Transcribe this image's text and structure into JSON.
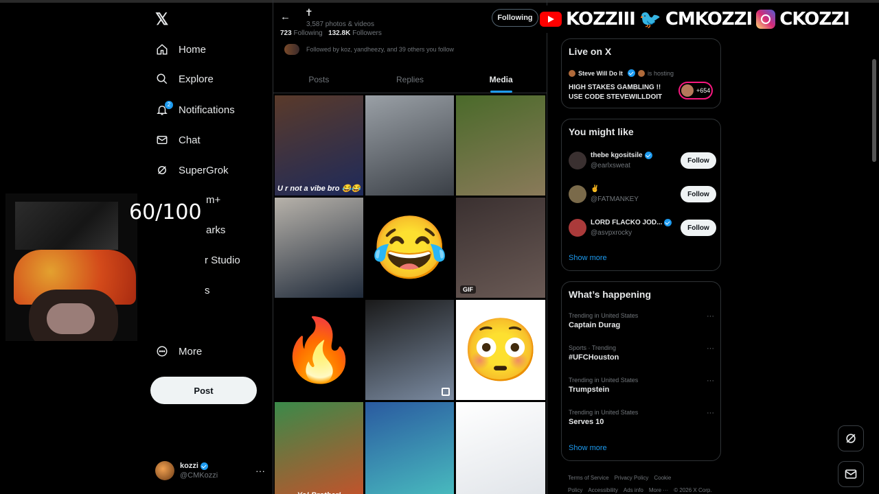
{
  "nav": {
    "items": [
      {
        "label": "Home",
        "icon": "home-icon"
      },
      {
        "label": "Explore",
        "icon": "search-icon"
      },
      {
        "label": "Notifications",
        "icon": "bell-icon",
        "badge": "2"
      },
      {
        "label": "Chat",
        "icon": "mail-icon"
      },
      {
        "label": "SuperGrok",
        "icon": "grok-icon"
      }
    ],
    "partial_items": [
      "m+",
      "arks",
      "r Studio",
      "s"
    ],
    "more_label": "More",
    "post_label": "Post",
    "account": {
      "name": "kozzi",
      "handle": "@CMKozzi",
      "more": "···"
    }
  },
  "overlay": {
    "score": "60/100",
    "banner": {
      "youtube": "KOZZIII",
      "twitter": "CMKOZZI",
      "instagram": "CKOZZI"
    }
  },
  "profile": {
    "media_count": "3,587 photos & videos",
    "following_count": "723",
    "following_label": "Following",
    "followers_count": "132.8K",
    "followers_label": "Followers",
    "followed_by": "Followed by koz, yandheezy, and 39 others you follow",
    "following_button": "Following",
    "tabs": [
      "Posts",
      "Replies",
      "Media"
    ],
    "active_tab": "Media"
  },
  "media": [
    {
      "caption": "U r not a vibe bro 😂😂",
      "colors": [
        "#5a3a2a",
        "#1e2a5a"
      ]
    },
    {
      "caption": "",
      "colors": [
        "#9aa0a6",
        "#3a3f46"
      ]
    },
    {
      "caption": "",
      "colors": [
        "#4a6a2a",
        "#8a7a5a"
      ]
    },
    {
      "caption": "",
      "colors": [
        "#b7b2aa",
        "#1f2a3a"
      ]
    },
    {
      "caption": "",
      "emoji": "😂",
      "colors": [
        "#000000",
        "#000000"
      ]
    },
    {
      "caption": "",
      "badge": "GIF",
      "colors": [
        "#3a3030",
        "#6a5a55"
      ]
    },
    {
      "caption": "",
      "emoji": "🔥",
      "colors": [
        "#000000",
        "#000000"
      ]
    },
    {
      "caption": "",
      "multi": true,
      "colors": [
        "#1a1a1a",
        "#7a8aa0"
      ]
    },
    {
      "caption": "",
      "emoji": "😳",
      "colors": [
        "#ffffff",
        "#ffffff"
      ]
    },
    {
      "caption": "Yo! Brother!",
      "colors": [
        "#3a8a4a",
        "#c9502a"
      ]
    },
    {
      "caption": "",
      "colors": [
        "#2a5aa0",
        "#4ac0c0"
      ]
    },
    {
      "caption": "",
      "colors": [
        "#ffffff",
        "#dfe3e8"
      ]
    }
  ],
  "live": {
    "title": "Live on X",
    "host_name": "Steve Will Do It",
    "host_action": "is hosting",
    "event": "HIGH STAKES GAMBLING !! USE CODE STEVEWILLDOIT",
    "listeners": "+654"
  },
  "suggest": {
    "title": "You might like",
    "users": [
      {
        "name": "thebe kgositsile",
        "handle": "@earlxsweat",
        "verified": true,
        "avatar": "#3a3030"
      },
      {
        "name": "✌️",
        "handle": "@FATMANKEY",
        "verified": false,
        "avatar": "#7a6a4a"
      },
      {
        "name": "LORD FLACKO JOD...",
        "handle": "@asvpxrocky",
        "verified": true,
        "avatar": "#aa3a3a"
      }
    ],
    "follow_label": "Follow",
    "show_more": "Show more"
  },
  "trends": {
    "title": "What’s happening",
    "items": [
      {
        "context": "Trending in United States",
        "topic": "Captain Durag"
      },
      {
        "context": "Sports · Trending",
        "topic": "#UFCHouston"
      },
      {
        "context": "Trending in United States",
        "topic": "Trumpstein"
      },
      {
        "context": "Trending in United States",
        "topic": "Serves 10"
      }
    ],
    "show_more": "Show more"
  },
  "footer": [
    "Terms of Service",
    "Privacy Policy",
    "Cookie Policy",
    "Accessibility",
    "Ads info",
    "More ···",
    "© 2026 X Corp."
  ]
}
